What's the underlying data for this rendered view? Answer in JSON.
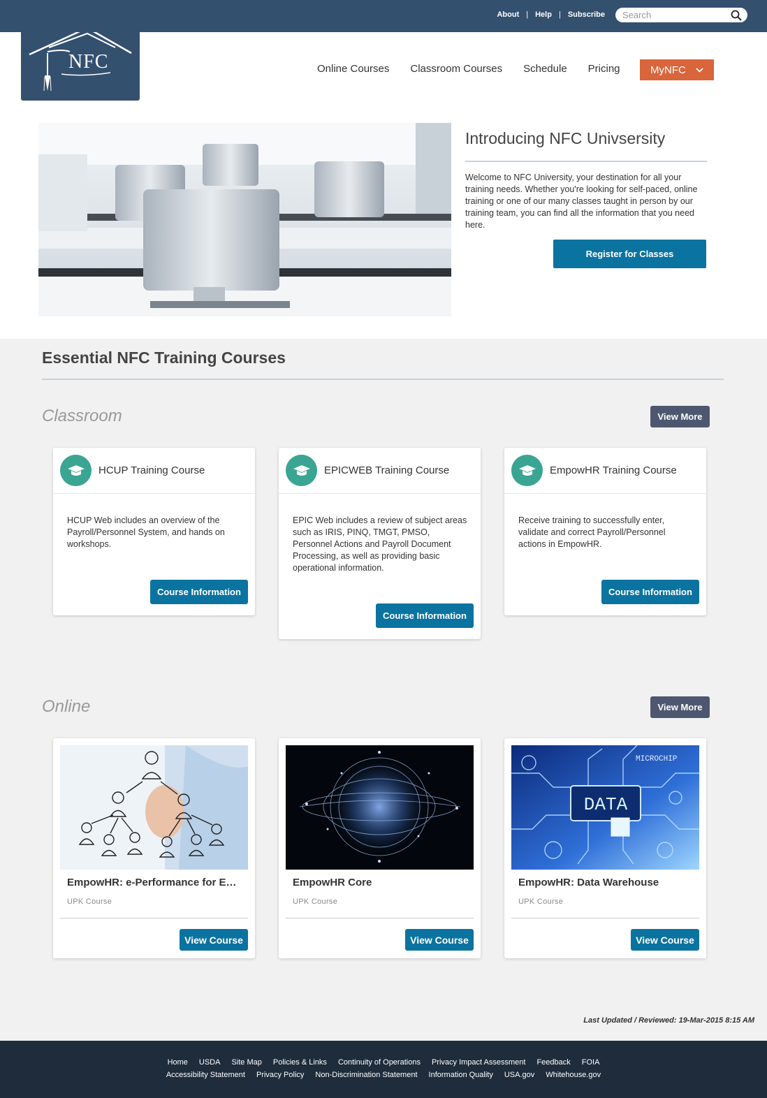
{
  "topbar": {
    "links": [
      "About",
      "Help",
      "Subscribe"
    ],
    "search_placeholder": "Search"
  },
  "logo": {
    "text": "NFC"
  },
  "nav": {
    "items": [
      "Online Courses",
      "Classroom Courses",
      "Schedule",
      "Pricing"
    ],
    "mynfc_label": "MyNFC"
  },
  "hero": {
    "title": "Introducing NFC Univsersity",
    "text": "Welcome to NFC University, your destination for all your training needs. Whether you're looking for self-paced, online training or one of our many classes taught in person by our training team, you can find all the information that you need here.",
    "button_label": "Register for Classes"
  },
  "courses": {
    "title": "Essential NFC Training Courses",
    "classroom": {
      "title": "Classroom",
      "view_more_label": "View More",
      "cards": [
        {
          "title": "HCUP Training Course",
          "description": "HCUP Web includes an overview of the Payroll/Personnel System, and hands on workshops.",
          "button_label": "Course Information"
        },
        {
          "title": "EPICWEB Training Course",
          "description": "EPIC Web includes a review of subject areas such as IRIS, PINQ, TMGT, PMSO, Personnel Actions and Payroll Document Processing, as well as providing basic operational information.",
          "button_label": "Course Information"
        },
        {
          "title": "EmpowHR Training Course",
          "description": "Receive training to successfully enter, validate and correct Payroll/Personnel actions in EmpowHR.",
          "button_label": "Course Information"
        }
      ]
    },
    "online": {
      "title": "Online",
      "view_more_label": "View More",
      "cards": [
        {
          "title": "EmpowHR: e-Performance for Employees",
          "subtitle": "UPK Course",
          "button_label": "View Course"
        },
        {
          "title": "EmpowHR Core",
          "subtitle": "UPK Course",
          "button_label": "View Course"
        },
        {
          "title": "EmpowHR: Data Warehouse",
          "subtitle": "UPK Course",
          "button_label": "View Course"
        }
      ],
      "data_image_text": "DATA",
      "microchip_text": "MICROCHIP"
    },
    "last_updated": "Last Updated / Reviewed: 19-Mar-2015 8:15 AM"
  },
  "footer": {
    "row1": [
      "Home",
      "USDA",
      "Site Map",
      "Policies & Links",
      "Continuity of Operations",
      "Privacy Impact Assessment",
      "Feedback",
      "FOIA"
    ],
    "row2": [
      "Accessibility Statement",
      "Privacy Policy",
      "Non-Discrimination Statement",
      "Information Quality",
      "USA.gov",
      "Whitehouse.gov"
    ]
  },
  "colors": {
    "header": "#34506f",
    "accent_orange": "#d9653b",
    "button_blue": "#0b73a0",
    "view_more": "#4d5870",
    "badge_teal": "#3aa592",
    "footer": "#1f2c3c"
  }
}
